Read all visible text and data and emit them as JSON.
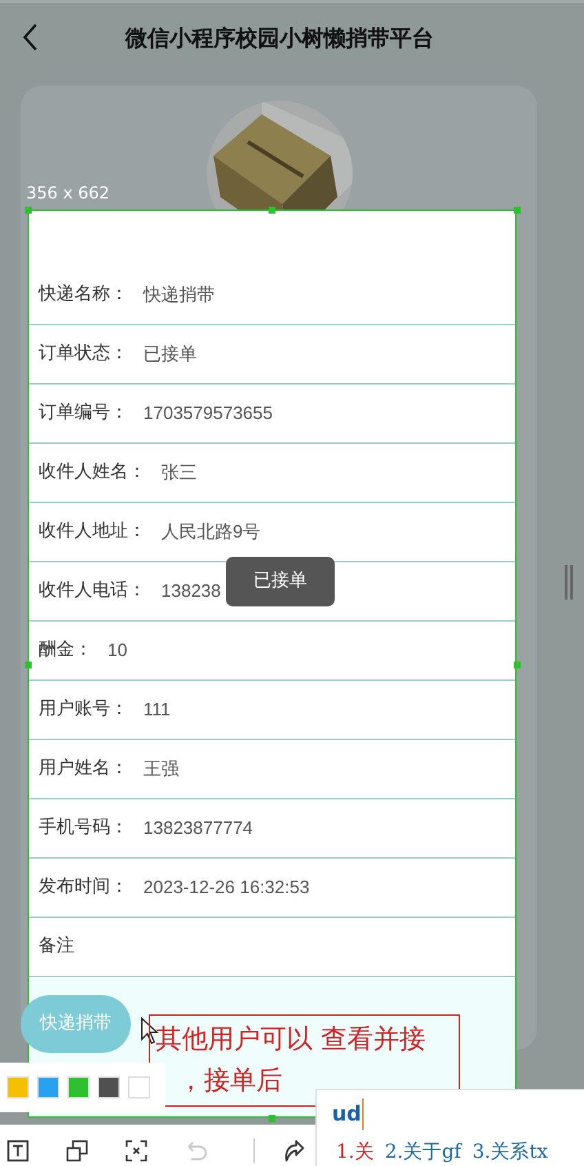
{
  "header": {
    "title": "微信小程序校园小树懒捎带平台"
  },
  "selection": {
    "size": "356 x 662"
  },
  "fields": [
    {
      "label": "快递名称：",
      "value": "快递捎带"
    },
    {
      "label": "订单状态：",
      "value": "已接单"
    },
    {
      "label": "订单编号：",
      "value": "1703579573655"
    },
    {
      "label": "收件人姓名：",
      "value": "张三"
    },
    {
      "label": "收件人地址：",
      "value": "人民北路9号"
    },
    {
      "label": "收件人电话：",
      "value": "138238"
    },
    {
      "label": "酬金：",
      "value": "10"
    },
    {
      "label": "用户账号：",
      "value": "111"
    },
    {
      "label": "用户姓名：",
      "value": "王强"
    },
    {
      "label": "手机号码：",
      "value": "13823877774"
    },
    {
      "label": "发布时间：",
      "value": "2023-12-26 16:32:53"
    },
    {
      "label": "备注"
    }
  ],
  "toast": "已接单",
  "float_button": "快递捎带",
  "annotation": {
    "lines": [
      "其他用户可以 查看并接",
      "，接单后"
    ]
  },
  "palette": [
    {
      "color": "#f5c000"
    },
    {
      "color": "#2aa0f0"
    },
    {
      "color": "#2fc02f"
    },
    {
      "color": "#505050"
    },
    {
      "color": "#ffffff"
    }
  ],
  "tools": [
    {
      "kind": "text",
      "disabled": false
    },
    {
      "kind": "mosaic",
      "disabled": false
    },
    {
      "kind": "blur",
      "disabled": false
    },
    {
      "kind": "undo",
      "disabled": true
    },
    {
      "kind": "redo",
      "disabled": false
    }
  ],
  "ime": {
    "composition": "ud",
    "candidates": [
      {
        "text": "1.关",
        "selected": true
      },
      {
        "text": "2.关于gf",
        "selected": false
      },
      {
        "text": "3.关系tx",
        "selected": false
      }
    ]
  }
}
